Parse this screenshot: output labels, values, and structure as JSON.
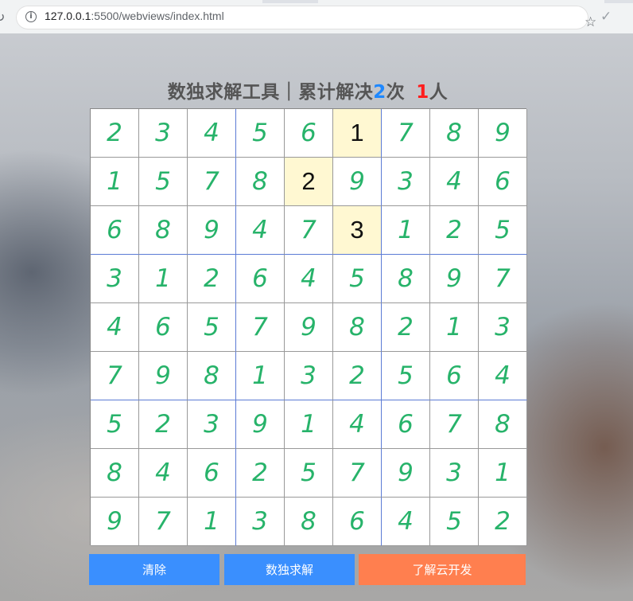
{
  "browser": {
    "url_host": "127.0.0.1",
    "url_path": ":5500/webviews/index.html",
    "info_icon": "info-icon",
    "star_icon": "star-icon",
    "check_icon": "check-icon"
  },
  "header": {
    "title_text": "数独求解工具｜累计解决",
    "solved_count": "2",
    "solved_unit": "次",
    "user_count": "1",
    "user_unit": "人"
  },
  "board": {
    "given_color": "#fff8d2",
    "solved_digit_color": "#27b36a",
    "rows": [
      [
        "2",
        "3",
        "4",
        "5",
        "6",
        "1",
        "7",
        "8",
        "9"
      ],
      [
        "1",
        "5",
        "7",
        "8",
        "2",
        "9",
        "3",
        "4",
        "6"
      ],
      [
        "6",
        "8",
        "9",
        "4",
        "7",
        "3",
        "1",
        "2",
        "5"
      ],
      [
        "3",
        "1",
        "2",
        "6",
        "4",
        "5",
        "8",
        "9",
        "7"
      ],
      [
        "4",
        "6",
        "5",
        "7",
        "9",
        "8",
        "2",
        "1",
        "3"
      ],
      [
        "7",
        "9",
        "8",
        "1",
        "3",
        "2",
        "5",
        "6",
        "4"
      ],
      [
        "5",
        "2",
        "3",
        "9",
        "1",
        "4",
        "6",
        "7",
        "8"
      ],
      [
        "8",
        "4",
        "6",
        "2",
        "5",
        "7",
        "9",
        "3",
        "1"
      ],
      [
        "9",
        "7",
        "1",
        "3",
        "8",
        "6",
        "4",
        "5",
        "2"
      ]
    ],
    "given": [
      [
        0,
        5
      ],
      [
        1,
        4
      ],
      [
        2,
        5
      ]
    ]
  },
  "buttons": {
    "clear_label": "清除",
    "solve_label": "数独求解",
    "cloud_label": "了解云开发"
  }
}
